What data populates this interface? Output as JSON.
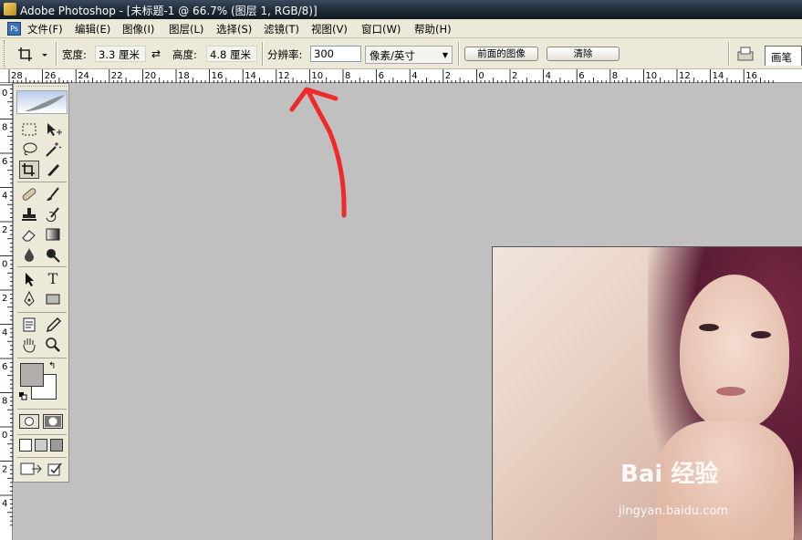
{
  "window": {
    "title": "Adobe Photoshop - [未标题-1 @ 66.7% (图层 1, RGB/8)]"
  },
  "menu": {
    "items": [
      "文件(F)",
      "编辑(E)",
      "图像(I)",
      "图层(L)",
      "选择(S)",
      "滤镜(T)",
      "视图(V)",
      "窗口(W)",
      "帮助(H)"
    ]
  },
  "options": {
    "width_label": "宽度:",
    "width_value": "3.3 厘米",
    "height_label": "高度:",
    "height_value": "4.8 厘米",
    "resolution_label": "分辨率:",
    "resolution_value": "300",
    "unit_selected": "像素/英寸",
    "front_image_button": "前面的图像",
    "clear_button": "清除",
    "brush_tab": "画笔"
  },
  "ruler": {
    "horizontal_labels": [
      "28",
      "26",
      "24",
      "22",
      "20",
      "18",
      "16",
      "14",
      "12",
      "10",
      "8",
      "6",
      "4",
      "2",
      "0",
      "2",
      "4",
      "6",
      "8",
      "10",
      "12",
      "14",
      "16"
    ],
    "vertical_labels": [
      "0",
      "8",
      "6",
      "4",
      "2",
      "0",
      "2",
      "4",
      "6",
      "8",
      "0",
      "2",
      "4"
    ]
  },
  "toolbox": {
    "foreground_color": "#b3aeab",
    "background_color": "#ffffff",
    "active_tool": "crop-tool"
  },
  "canvas": {
    "background_color": "#c0c0c0"
  },
  "annotation": {
    "color": "#ee2a2a",
    "type": "arrow-pointing-to-resolution-field"
  },
  "photo": {
    "watermark_main": "Bai 经验",
    "watermark_url": "jingyan.baidu.com"
  }
}
